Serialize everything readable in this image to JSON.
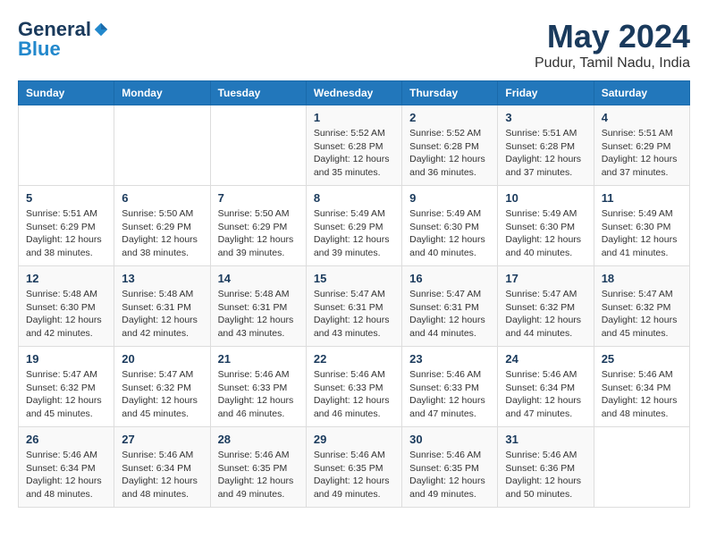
{
  "logo": {
    "general": "General",
    "blue": "Blue"
  },
  "title": "May 2024",
  "location": "Pudur, Tamil Nadu, India",
  "weekdays": [
    "Sunday",
    "Monday",
    "Tuesday",
    "Wednesday",
    "Thursday",
    "Friday",
    "Saturday"
  ],
  "weeks": [
    [
      {
        "day": "",
        "sunrise": "",
        "sunset": "",
        "daylight": ""
      },
      {
        "day": "",
        "sunrise": "",
        "sunset": "",
        "daylight": ""
      },
      {
        "day": "",
        "sunrise": "",
        "sunset": "",
        "daylight": ""
      },
      {
        "day": "1",
        "sunrise": "Sunrise: 5:52 AM",
        "sunset": "Sunset: 6:28 PM",
        "daylight": "Daylight: 12 hours and 35 minutes."
      },
      {
        "day": "2",
        "sunrise": "Sunrise: 5:52 AM",
        "sunset": "Sunset: 6:28 PM",
        "daylight": "Daylight: 12 hours and 36 minutes."
      },
      {
        "day": "3",
        "sunrise": "Sunrise: 5:51 AM",
        "sunset": "Sunset: 6:28 PM",
        "daylight": "Daylight: 12 hours and 37 minutes."
      },
      {
        "day": "4",
        "sunrise": "Sunrise: 5:51 AM",
        "sunset": "Sunset: 6:29 PM",
        "daylight": "Daylight: 12 hours and 37 minutes."
      }
    ],
    [
      {
        "day": "5",
        "sunrise": "Sunrise: 5:51 AM",
        "sunset": "Sunset: 6:29 PM",
        "daylight": "Daylight: 12 hours and 38 minutes."
      },
      {
        "day": "6",
        "sunrise": "Sunrise: 5:50 AM",
        "sunset": "Sunset: 6:29 PM",
        "daylight": "Daylight: 12 hours and 38 minutes."
      },
      {
        "day": "7",
        "sunrise": "Sunrise: 5:50 AM",
        "sunset": "Sunset: 6:29 PM",
        "daylight": "Daylight: 12 hours and 39 minutes."
      },
      {
        "day": "8",
        "sunrise": "Sunrise: 5:49 AM",
        "sunset": "Sunset: 6:29 PM",
        "daylight": "Daylight: 12 hours and 39 minutes."
      },
      {
        "day": "9",
        "sunrise": "Sunrise: 5:49 AM",
        "sunset": "Sunset: 6:30 PM",
        "daylight": "Daylight: 12 hours and 40 minutes."
      },
      {
        "day": "10",
        "sunrise": "Sunrise: 5:49 AM",
        "sunset": "Sunset: 6:30 PM",
        "daylight": "Daylight: 12 hours and 40 minutes."
      },
      {
        "day": "11",
        "sunrise": "Sunrise: 5:49 AM",
        "sunset": "Sunset: 6:30 PM",
        "daylight": "Daylight: 12 hours and 41 minutes."
      }
    ],
    [
      {
        "day": "12",
        "sunrise": "Sunrise: 5:48 AM",
        "sunset": "Sunset: 6:30 PM",
        "daylight": "Daylight: 12 hours and 42 minutes."
      },
      {
        "day": "13",
        "sunrise": "Sunrise: 5:48 AM",
        "sunset": "Sunset: 6:31 PM",
        "daylight": "Daylight: 12 hours and 42 minutes."
      },
      {
        "day": "14",
        "sunrise": "Sunrise: 5:48 AM",
        "sunset": "Sunset: 6:31 PM",
        "daylight": "Daylight: 12 hours and 43 minutes."
      },
      {
        "day": "15",
        "sunrise": "Sunrise: 5:47 AM",
        "sunset": "Sunset: 6:31 PM",
        "daylight": "Daylight: 12 hours and 43 minutes."
      },
      {
        "day": "16",
        "sunrise": "Sunrise: 5:47 AM",
        "sunset": "Sunset: 6:31 PM",
        "daylight": "Daylight: 12 hours and 44 minutes."
      },
      {
        "day": "17",
        "sunrise": "Sunrise: 5:47 AM",
        "sunset": "Sunset: 6:32 PM",
        "daylight": "Daylight: 12 hours and 44 minutes."
      },
      {
        "day": "18",
        "sunrise": "Sunrise: 5:47 AM",
        "sunset": "Sunset: 6:32 PM",
        "daylight": "Daylight: 12 hours and 45 minutes."
      }
    ],
    [
      {
        "day": "19",
        "sunrise": "Sunrise: 5:47 AM",
        "sunset": "Sunset: 6:32 PM",
        "daylight": "Daylight: 12 hours and 45 minutes."
      },
      {
        "day": "20",
        "sunrise": "Sunrise: 5:47 AM",
        "sunset": "Sunset: 6:32 PM",
        "daylight": "Daylight: 12 hours and 45 minutes."
      },
      {
        "day": "21",
        "sunrise": "Sunrise: 5:46 AM",
        "sunset": "Sunset: 6:33 PM",
        "daylight": "Daylight: 12 hours and 46 minutes."
      },
      {
        "day": "22",
        "sunrise": "Sunrise: 5:46 AM",
        "sunset": "Sunset: 6:33 PM",
        "daylight": "Daylight: 12 hours and 46 minutes."
      },
      {
        "day": "23",
        "sunrise": "Sunrise: 5:46 AM",
        "sunset": "Sunset: 6:33 PM",
        "daylight": "Daylight: 12 hours and 47 minutes."
      },
      {
        "day": "24",
        "sunrise": "Sunrise: 5:46 AM",
        "sunset": "Sunset: 6:34 PM",
        "daylight": "Daylight: 12 hours and 47 minutes."
      },
      {
        "day": "25",
        "sunrise": "Sunrise: 5:46 AM",
        "sunset": "Sunset: 6:34 PM",
        "daylight": "Daylight: 12 hours and 48 minutes."
      }
    ],
    [
      {
        "day": "26",
        "sunrise": "Sunrise: 5:46 AM",
        "sunset": "Sunset: 6:34 PM",
        "daylight": "Daylight: 12 hours and 48 minutes."
      },
      {
        "day": "27",
        "sunrise": "Sunrise: 5:46 AM",
        "sunset": "Sunset: 6:34 PM",
        "daylight": "Daylight: 12 hours and 48 minutes."
      },
      {
        "day": "28",
        "sunrise": "Sunrise: 5:46 AM",
        "sunset": "Sunset: 6:35 PM",
        "daylight": "Daylight: 12 hours and 49 minutes."
      },
      {
        "day": "29",
        "sunrise": "Sunrise: 5:46 AM",
        "sunset": "Sunset: 6:35 PM",
        "daylight": "Daylight: 12 hours and 49 minutes."
      },
      {
        "day": "30",
        "sunrise": "Sunrise: 5:46 AM",
        "sunset": "Sunset: 6:35 PM",
        "daylight": "Daylight: 12 hours and 49 minutes."
      },
      {
        "day": "31",
        "sunrise": "Sunrise: 5:46 AM",
        "sunset": "Sunset: 6:36 PM",
        "daylight": "Daylight: 12 hours and 50 minutes."
      },
      {
        "day": "",
        "sunrise": "",
        "sunset": "",
        "daylight": ""
      }
    ]
  ]
}
